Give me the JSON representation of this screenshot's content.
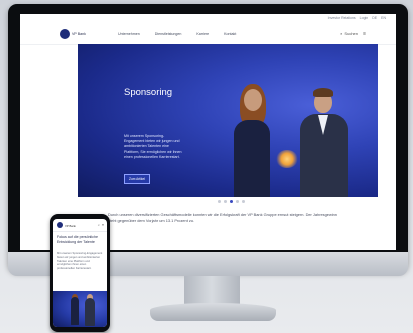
{
  "colors": {
    "brand_blue": "#1f2d7a",
    "hero_blue": "#2f43b6",
    "screen_bg": "#ffffff"
  },
  "utility_links": [
    "Investor Relations",
    "Login",
    "DE",
    "EN"
  ],
  "nav": {
    "logo_text": "VP Bank",
    "items": [
      "Unternehmen",
      "Dienstleistungen",
      "Karriere",
      "Kontakt"
    ],
    "search_label": "Suchen",
    "search_icon": "search-icon",
    "menu_icon": "hamburger-icon"
  },
  "hero": {
    "title": "Sponsoring",
    "text": "Mit unserem Sponsoring-Engagement bieten wir jungen und ambitionierten Talenten eine Plattform, Sie ermöglichen wir ihnen einen professionellen Karrierestart.",
    "button_label": "Zum Artikel",
    "slides": 5,
    "active_slide": 3
  },
  "body_text": "Durch unseren diversifizierten Geschäftsmodelle konnten wir die Erfolgskraft der VP Bank Gruppe ernsut steigern. Der Jahresgewinn steht gegenüber dem Vorjahr um 13.1 Prozent zu.",
  "phone": {
    "logo_text": "VP Bank",
    "headline": "Fokus auf die persönliche Entwicklung der Talente",
    "text": "Mit unserem Sponsoring-Engagement bieten wir jungen und ambitionierten Talenten eine Plattform und ermöglichen ihnen einen professionellen Karrierestart."
  }
}
